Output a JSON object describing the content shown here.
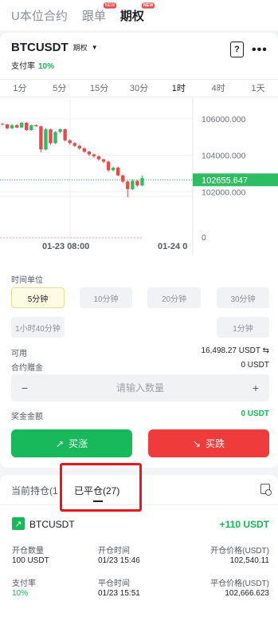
{
  "top_tabs": [
    {
      "label": "U本位合约",
      "badge": ""
    },
    {
      "label": "跟单",
      "badge": "NEW"
    },
    {
      "label": "期权",
      "badge": "NEW"
    }
  ],
  "header": {
    "symbol": "BTCUSDT",
    "option_label": "期权",
    "funding_label": "支付率",
    "funding_value": "10%",
    "help_glyph": "?",
    "more_glyph": "•••"
  },
  "chart": {
    "intervals": [
      "1分",
      "5分",
      "15分",
      "30分",
      "1时",
      "4时",
      "1天"
    ],
    "active_interval": "1时",
    "price_ticks": [
      "106000.000",
      "104000.000",
      "102000.000"
    ],
    "secondary_tick": "0",
    "current_price": "102655.647",
    "time_labels": [
      "01-23 08:00",
      "01-24 0"
    ]
  },
  "chart_data": {
    "type": "candlestick",
    "ylim": [
      100700,
      107000
    ],
    "y_ticks": [
      106000,
      104000,
      102000
    ],
    "current_price": 102655.647,
    "x_labels": [
      "01-23 08:00",
      "01-24 0"
    ],
    "candles": [
      {
        "o": 105720,
        "c": 105690,
        "h": 105770,
        "l": 105660
      },
      {
        "o": 105690,
        "c": 105480,
        "h": 105740,
        "l": 105420
      },
      {
        "o": 105480,
        "c": 105650,
        "h": 105720,
        "l": 105440
      },
      {
        "o": 105650,
        "c": 105520,
        "h": 105700,
        "l": 105490
      },
      {
        "o": 105520,
        "c": 105780,
        "h": 105840,
        "l": 105500
      },
      {
        "o": 105780,
        "c": 105380,
        "h": 105820,
        "l": 105340
      },
      {
        "o": 105380,
        "c": 105650,
        "h": 105690,
        "l": 105340
      },
      {
        "o": 105650,
        "c": 105590,
        "h": 105700,
        "l": 105550
      },
      {
        "o": 105590,
        "c": 104320,
        "h": 105620,
        "l": 104160
      },
      {
        "o": 104320,
        "c": 105420,
        "h": 105500,
        "l": 104270
      },
      {
        "o": 105420,
        "c": 104660,
        "h": 105450,
        "l": 104580
      },
      {
        "o": 104660,
        "c": 105280,
        "h": 105320,
        "l": 104620
      },
      {
        "o": 105280,
        "c": 105430,
        "h": 105480,
        "l": 105200
      },
      {
        "o": 105430,
        "c": 104820,
        "h": 105470,
        "l": 104760
      },
      {
        "o": 104820,
        "c": 104670,
        "h": 104890,
        "l": 104580
      },
      {
        "o": 104670,
        "c": 104520,
        "h": 104720,
        "l": 104460
      },
      {
        "o": 104520,
        "c": 104380,
        "h": 104570,
        "l": 104300
      },
      {
        "o": 104380,
        "c": 104200,
        "h": 104450,
        "l": 104120
      },
      {
        "o": 104200,
        "c": 104050,
        "h": 104250,
        "l": 103960
      },
      {
        "o": 104050,
        "c": 103950,
        "h": 104100,
        "l": 103880
      },
      {
        "o": 103950,
        "c": 103780,
        "h": 104000,
        "l": 103700
      },
      {
        "o": 103780,
        "c": 103650,
        "h": 103820,
        "l": 103560
      },
      {
        "o": 103650,
        "c": 103180,
        "h": 103700,
        "l": 103080
      },
      {
        "o": 103180,
        "c": 103320,
        "h": 103390,
        "l": 103120
      },
      {
        "o": 103320,
        "c": 102900,
        "h": 103380,
        "l": 102850
      },
      {
        "o": 102900,
        "c": 102560,
        "h": 102950,
        "l": 102480
      },
      {
        "o": 102560,
        "c": 102150,
        "h": 102620,
        "l": 101700
      },
      {
        "o": 102150,
        "c": 102600,
        "h": 102690,
        "l": 102080
      },
      {
        "o": 102600,
        "c": 102350,
        "h": 102650,
        "l": 102280
      },
      {
        "o": 102350,
        "c": 102750,
        "h": 102900,
        "l": 102300
      }
    ]
  },
  "settings": {
    "time_unit_label": "时间单位",
    "durations": [
      "5分钟",
      "10分钟",
      "20分钟",
      "30分钟",
      "1小时40分钟",
      "1分钟"
    ],
    "active_duration": "5分钟",
    "available_label": "可用",
    "available_value": "16,498.27 USDT",
    "swap_glyph": "⇆",
    "bonus_label": "合约赠金",
    "bonus_value": "0 USDT",
    "qty_placeholder": "请输入数量",
    "minus_glyph": "−",
    "plus_glyph": "+",
    "reward_label": "奖金金额",
    "reward_value": "0 USDT",
    "buy_up": "买涨",
    "buy_down": "买跌",
    "up_arrow": "↗",
    "down_arrow": "↘"
  },
  "positions": {
    "tab_current": "当前持仓(1",
    "tab_closed": "已平仓(27)",
    "trade": {
      "arrow": "↗",
      "symbol": "BTCUSDT",
      "pnl": "+110 USDT",
      "qty_label": "开仓数量",
      "qty_value": "100 USDT",
      "open_time_label": "开仓时间",
      "open_time_value": "01/23 15:46",
      "open_price_label": "开仓价格(USDT)",
      "open_price_value": "102,540.11",
      "rate_label": "支付率",
      "rate_value": "10%",
      "close_time_label": "平仓时间",
      "close_time_value": "01/23 15:51",
      "close_price_label": "平仓价格(USDT)",
      "close_price_value": "102,666.623"
    }
  },
  "colors": {
    "up": "#18b95a",
    "down": "#ef3b3b",
    "candle_up": "#2ebd62",
    "candle_down": "#e84a4a",
    "highlight": "#e5191d"
  }
}
